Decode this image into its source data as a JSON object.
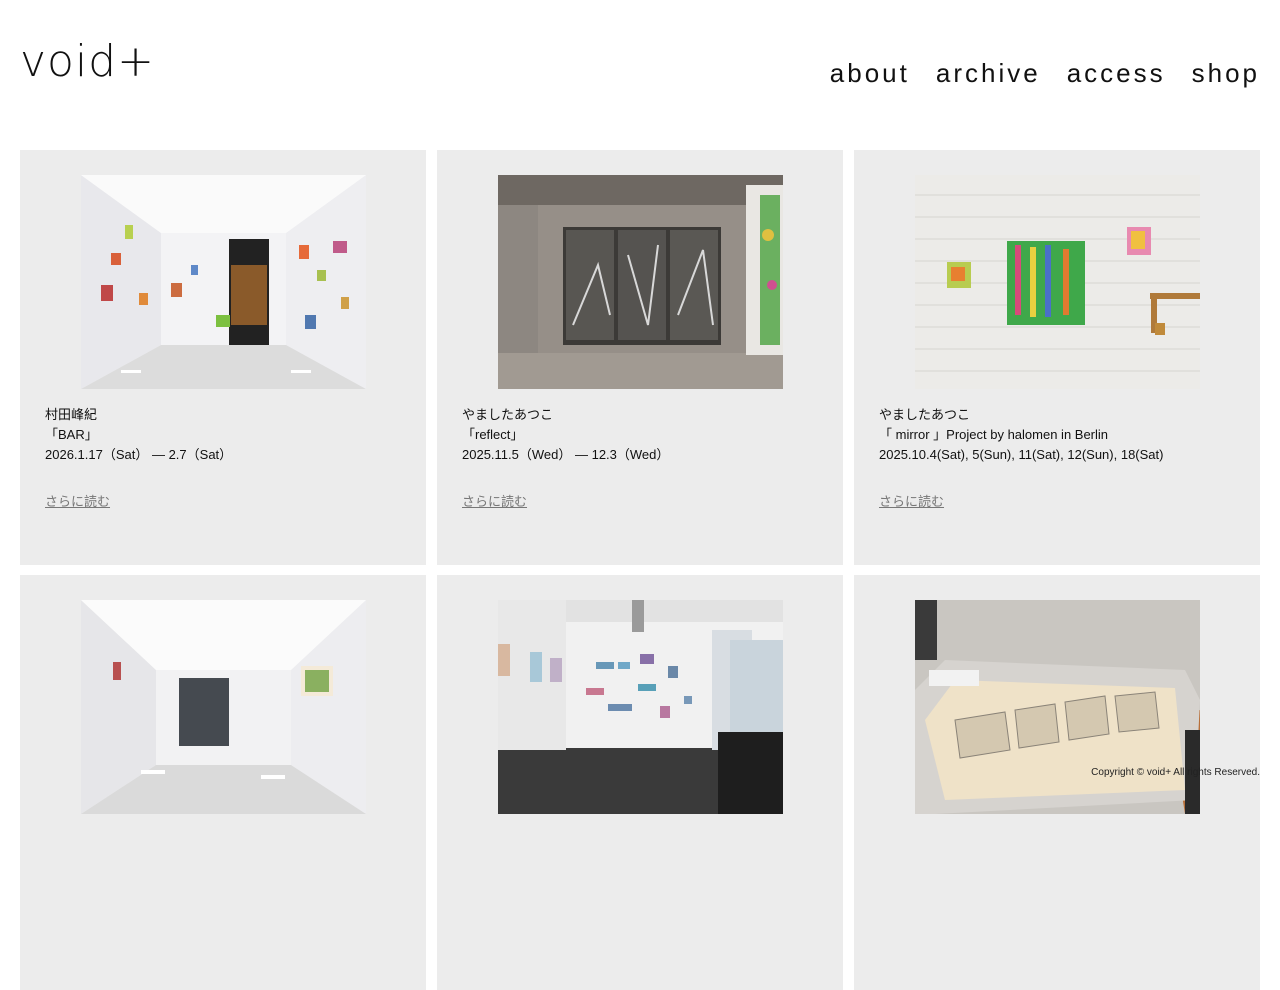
{
  "header": {
    "logo": "void+",
    "nav": [
      "about",
      "archive",
      "access",
      "shop"
    ]
  },
  "cards": [
    {
      "artist": "村田峰紀",
      "title": "「BAR」",
      "date": "2026.1.17（Sat） — 2.7（Sat）",
      "more": "さらに読む"
    },
    {
      "artist": "やましたあつこ",
      "title": "「reflect」",
      "date": "2025.11.5（Wed） — 12.3（Wed）",
      "more": "さらに読む"
    },
    {
      "artist": "やましたあつこ",
      "title": "「 mirror 」Project by halomen in Berlin",
      "date": "2025.10.4(Sat), 5(Sun), 11(Sat), 12(Sun), 18(Sat)",
      "more": "さらに読む"
    },
    {
      "artist": "",
      "title": "",
      "date": "",
      "more": ""
    },
    {
      "artist": "",
      "title": "",
      "date": "",
      "more": ""
    },
    {
      "artist": "",
      "title": "",
      "date": "",
      "more": ""
    }
  ],
  "footer": {
    "copyright": "Copyright © void+ All rights Reserved."
  },
  "colors": {
    "card_bg": "#ececec",
    "text": "#111111",
    "link": "#777777"
  }
}
